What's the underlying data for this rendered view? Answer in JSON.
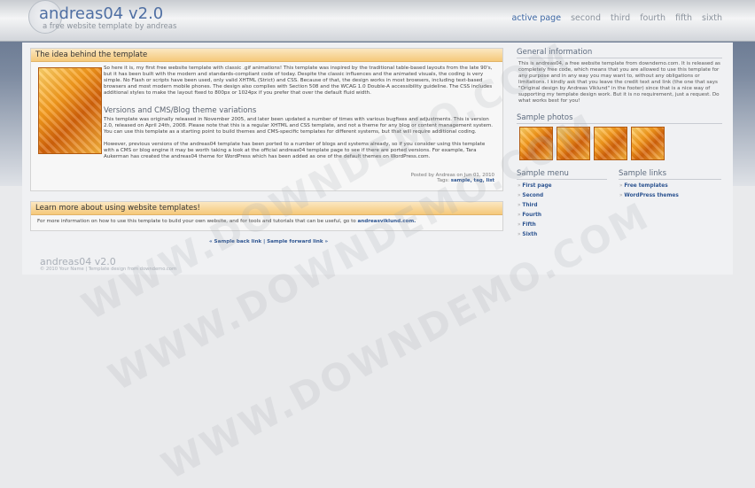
{
  "header": {
    "title": "andreas04 v2.0",
    "subtitle": "a free website template by andreas",
    "nav": [
      "active page",
      "second",
      "third",
      "fourth",
      "fifth",
      "sixth"
    ]
  },
  "main": {
    "box1_title": "The idea behind the template",
    "intro_text": "So here it is, my first free website template with classic .gif animations! This template was inspired by the traditional table-based layouts from the late 90's, but it has been built with the modern and standards-compliant code of today. Despite the classic influences and the animated visuals, the coding is very simple. No Flash or scripts have been used, only valid XHTML (Strict) and CSS. Because of that, the design works in most browsers, including text-based browsers and most modern mobile phones. The design also complies with Section 508 and the WCAG 1.0 Double-A accessibility guideline. The CSS includes additional styles to make the layout fixed to 800px or 1024px if you prefer that over the default fluid width.",
    "subheading": "Versions and CMS/Blog theme variations",
    "versions_text": "This template was originally released in November 2005, and later been updated a number of times with various bugfixes and adjustments. This is version 2.0, released on April 24th, 2008. Please note that this is a regular XHTML and CSS template, and not a theme for any blog or content management system. You can use this template as a starting point to build themes and CMS-specific templates for different systems, but that will require additional coding.",
    "ports_text": "However, previous versions of the andreas04 template has been ported to a number of blogs and systems already, so if you consider using this template with a CMS or blog engine it may be worth taking a look at the official andreas04 template page to see if there are ported versions. For example, Tara Aukerman has created the andreas04 theme for WordPress which has been added as one of the default themes on WordPress.com.",
    "posted_by": "Posted by Andreas on Jun 01, 2010",
    "tags_label": "Tags:",
    "tags": "sample, tag, list",
    "box2_title": "Learn more about using website templates!",
    "learn_text": "For more information on how to use this template to build your own website, and for tools and tutorials that can be useful, go to",
    "learn_link": "andreasviklund.com.",
    "nav_links": "« Sample back link | Sample forward link »"
  },
  "sidebar": {
    "general_title": "General information",
    "general_text": "This is andreas04, a free website template from downdemo.com. It is released as completely free code, which means that you are allowed to use this template for any purpose and in any way you may want to, without any obligations or limitations. I kindly ask that you leave the credit text and link (the one that says \"Original design by Andreas Viklund\" in the footer) since that is a nice way of supporting my template design work. But it is no requirement, just a request. Do what works best for you!",
    "photos_title": "Sample photos",
    "menu_title": "Sample menu",
    "menu_items": [
      "First page",
      "Second",
      "Third",
      "Fourth",
      "Fifth",
      "Sixth"
    ],
    "links_title": "Sample links",
    "links_items": [
      "Free templates",
      "WordPress themes"
    ]
  },
  "footer": {
    "title": "andreas04 v2.0",
    "text": "© 2010 Your Name | Template design from downdemo.com"
  },
  "watermark": "WWW.DOWNDEMO.COM"
}
